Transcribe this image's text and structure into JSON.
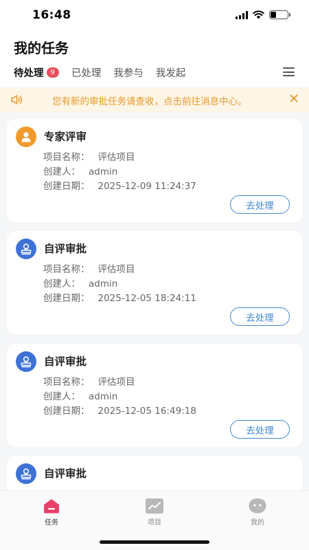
{
  "status_bar": {
    "time": "16:48"
  },
  "header": {
    "title": "我的任务"
  },
  "tabs": [
    {
      "label": "待处理",
      "badge": "9",
      "active": true
    },
    {
      "label": "已处理",
      "active": false
    },
    {
      "label": "我参与",
      "active": false
    },
    {
      "label": "我发起",
      "active": false
    }
  ],
  "notice": {
    "text": "您有新的审批任务请查收，点击前往消息中心。",
    "close": "✕"
  },
  "tasks": [
    {
      "title": "专家评审",
      "icon": "expert-person-icon",
      "icon_color": "#f19a2c",
      "project_label": "项目名称：",
      "project_value": "评估项目",
      "creator_label": "创建人：",
      "creator_value": "admin",
      "date_label": "创建日期：",
      "date_value": "2025-12-09 11:24:37",
      "action": "去处理"
    },
    {
      "title": "自评审批",
      "icon": "approval-stamp-icon",
      "icon_color": "#3e72d6",
      "project_label": "项目名称：",
      "project_value": "评估项目",
      "creator_label": "创建人：",
      "creator_value": "admin",
      "date_label": "创建日期：",
      "date_value": "2025-12-05 18:24:11",
      "action": "去处理"
    },
    {
      "title": "自评审批",
      "icon": "approval-stamp-icon",
      "icon_color": "#3e72d6",
      "project_label": "项目名称：",
      "project_value": "评估项目",
      "creator_label": "创建人：",
      "creator_value": "admin",
      "date_label": "创建日期：",
      "date_value": "2025-12-05 16:49:18",
      "action": "去处理"
    },
    {
      "title": "自评审批",
      "icon": "approval-stamp-icon",
      "icon_color": "#3e72d6"
    }
  ],
  "bottom_nav": [
    {
      "label": "任务",
      "icon": "task-home-icon",
      "active": true,
      "color": "#e8416a"
    },
    {
      "label": "项目",
      "icon": "project-chart-icon",
      "active": false,
      "color": "#b8b8b8"
    },
    {
      "label": "我的",
      "icon": "profile-face-icon",
      "active": false,
      "color": "#b8b8b8"
    }
  ]
}
